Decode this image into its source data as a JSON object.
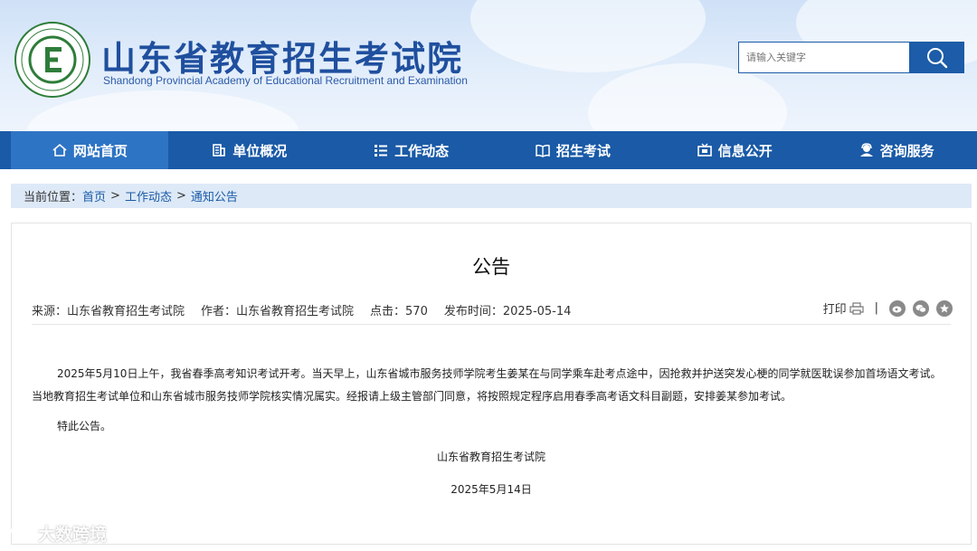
{
  "header": {
    "title": "山东省教育招生考试院",
    "subtitle": "Shandong Provincial Academy of Educational Recruitment and Examination",
    "logo_letter": "E",
    "search_placeholder": "请输入关键字",
    "search_icon": "search-icon"
  },
  "nav": {
    "items": [
      {
        "label": "网站首页",
        "icon": "home-icon"
      },
      {
        "label": "单位概况",
        "icon": "building-icon"
      },
      {
        "label": "工作动态",
        "icon": "list-icon"
      },
      {
        "label": "招生考试",
        "icon": "book-icon"
      },
      {
        "label": "信息公开",
        "icon": "info-board-icon"
      },
      {
        "label": "咨询服务",
        "icon": "consult-icon"
      }
    ]
  },
  "breadcrumb": {
    "prefix": "当前位置：",
    "items": [
      "首页",
      "工作动态",
      "通知公告"
    ],
    "separator": ">"
  },
  "article": {
    "title": "公告",
    "meta": {
      "source": "来源：山东省教育招生考试院",
      "author": "作者：山东省教育招生考试院",
      "clicks": "点击：570",
      "published": "发布时间：2025-05-14"
    },
    "print_label": "打印",
    "share_separator": "|",
    "paragraph": "2025年5月10日上午，我省春季高考知识考试开考。当天早上，山东省城市服务技师学院考生姜某在与同学乘车赴考点途中，因抢救并护送突发心梗的同学就医耽误参加首场语文考试。当地教育招生考试单位和山东省城市服务技师学院核实情况属实。经报请上级主管部门同意，将按照规定程序启用春季高考语文科目副题，安排姜某参加考试。",
    "notice": "特此公告。",
    "signature_org": "山东省教育招生考试院",
    "signature_date": "2025年5月14日"
  },
  "watermark": {
    "text": "大数跨境"
  },
  "colors": {
    "brand": "#1a5aa6",
    "nav_active": "#2e74c4",
    "breadcrumb_bg": "#dde9f7"
  }
}
